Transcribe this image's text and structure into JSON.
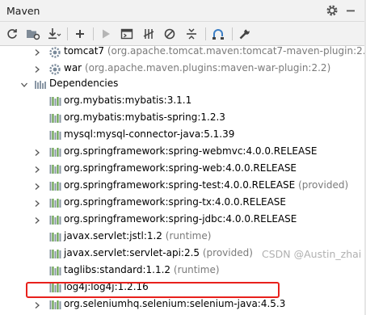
{
  "window": {
    "title": "Maven",
    "settings_icon": "gear-icon",
    "minimize_icon": "minimize-icon"
  },
  "toolbar": {
    "buttons": [
      {
        "name": "reload-all-maven-projects-button",
        "icon": "refresh-icon"
      },
      {
        "name": "generate-sources-button",
        "icon": "folder-gear-icon"
      },
      {
        "name": "download-sources-button",
        "icon": "download-icon"
      },
      {
        "name": "add-maven-project-button",
        "icon": "plus-icon"
      },
      {
        "name": "run-maven-build-button",
        "icon": "play-icon"
      },
      {
        "name": "execute-maven-goal-button",
        "icon": "maven-goal-icon"
      },
      {
        "name": "toggle-offline-mode-button",
        "icon": "offline-toggle-icon"
      },
      {
        "name": "skip-tests-button",
        "icon": "skip-tests-icon"
      },
      {
        "name": "collapse-all-button",
        "icon": "collapse-icon"
      },
      {
        "name": "show-dependencies-button",
        "icon": "dependency-diagram-icon"
      },
      {
        "name": "maven-settings-button",
        "icon": "wrench-icon"
      }
    ]
  },
  "tree": {
    "plugins": [
      {
        "name": "tomcat7",
        "detail": "(org.apache.tomcat.maven:tomcat7-maven-plugin:2.2)"
      },
      {
        "name": "war",
        "detail": "(org.apache.maven.plugins:maven-war-plugin:2.2)"
      }
    ],
    "dependencies_label": "Dependencies",
    "dependencies": [
      {
        "label": "org.mybatis:mybatis:3.1.1",
        "scope": "",
        "expandable": false
      },
      {
        "label": "org.mybatis:mybatis-spring:1.2.3",
        "scope": "",
        "expandable": false
      },
      {
        "label": "mysql:mysql-connector-java:5.1.39",
        "scope": "",
        "expandable": false
      },
      {
        "label": "org.springframework:spring-webmvc:4.0.0.RELEASE",
        "scope": "",
        "expandable": true
      },
      {
        "label": "org.springframework:spring-web:4.0.0.RELEASE",
        "scope": "",
        "expandable": true
      },
      {
        "label": "org.springframework:spring-test:4.0.0.RELEASE",
        "scope": "(provided)",
        "expandable": true
      },
      {
        "label": "org.springframework:spring-tx:4.0.0.RELEASE",
        "scope": "",
        "expandable": true
      },
      {
        "label": "org.springframework:spring-jdbc:4.0.0.RELEASE",
        "scope": "",
        "expandable": true
      },
      {
        "label": "javax.servlet:jstl:1.2",
        "scope": "(runtime)",
        "expandable": false
      },
      {
        "label": "javax.servlet:servlet-api:2.5",
        "scope": "(provided)",
        "expandable": false
      },
      {
        "label": "taglibs:standard:1.1.2",
        "scope": "(runtime)",
        "expandable": false
      },
      {
        "label": "log4j:log4j:1.2.16",
        "scope": "",
        "expandable": false
      },
      {
        "label": "org.seleniumhq.selenium:selenium-java:4.5.3",
        "scope": "",
        "expandable": true
      }
    ],
    "highlighted_dependency": "org.seleniumhq.selenium:selenium-java:4.5.3",
    "highlight_color": "#e8211c"
  },
  "watermark": "CSDN @Austin_zhai",
  "colors": {
    "accent_blue": "#3c7ec4",
    "library_green": "#5d9b43",
    "scope_gray": "#7a7a7a"
  }
}
